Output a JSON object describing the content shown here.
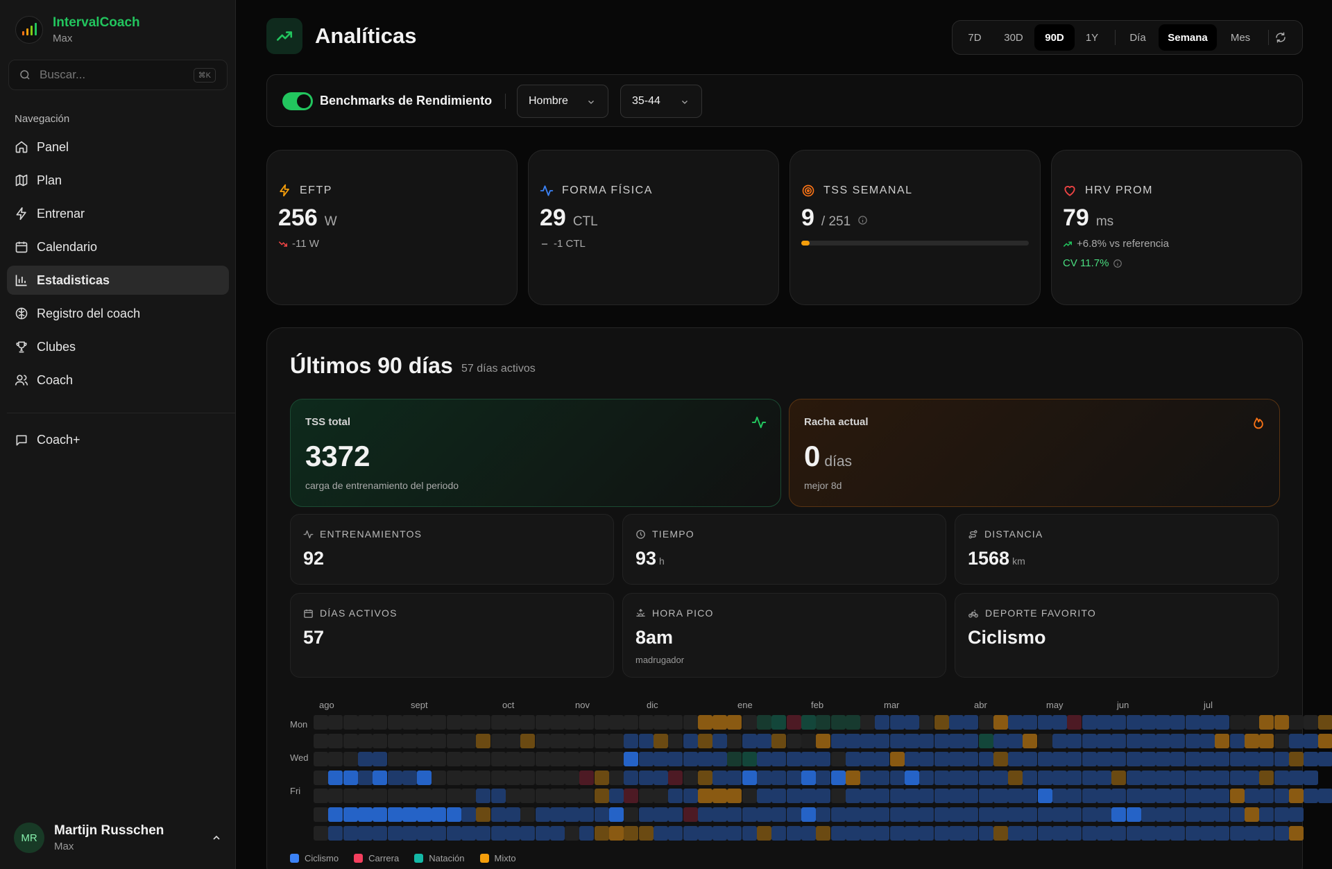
{
  "app": {
    "name": "IntervalCoach",
    "subtitle": "Max"
  },
  "search": {
    "placeholder": "Buscar...",
    "shortcut": "⌘K"
  },
  "nav": {
    "title": "Navegación",
    "items": [
      {
        "label": "Panel",
        "icon": "home-icon",
        "active": false
      },
      {
        "label": "Plan",
        "icon": "map-icon",
        "active": false
      },
      {
        "label": "Entrenar",
        "icon": "zap-icon",
        "active": false
      },
      {
        "label": "Calendario",
        "icon": "calendar-icon",
        "active": false
      },
      {
        "label": "Estadisticas",
        "icon": "bar-chart-icon",
        "active": true
      },
      {
        "label": "Registro del coach",
        "icon": "brain-icon",
        "active": false
      },
      {
        "label": "Clubes",
        "icon": "trophy-icon",
        "active": false
      },
      {
        "label": "Coach",
        "icon": "users-icon",
        "active": false
      }
    ],
    "extra": {
      "label": "Coach+",
      "icon": "message-icon"
    }
  },
  "user": {
    "initials": "MR",
    "name": "Martijn Russchen",
    "plan": "Max"
  },
  "page": {
    "title": "Analíticas",
    "icon": "trending-up-icon"
  },
  "range": {
    "periods": [
      "7D",
      "30D",
      "90D",
      "1Y"
    ],
    "active_period": "90D",
    "granularity": [
      "Día",
      "Semana",
      "Mes"
    ],
    "active_granularity": "Semana"
  },
  "benchmarks": {
    "label": "Benchmarks de Rendimiento",
    "enabled": true,
    "gender": "Hombre",
    "age": "35-44"
  },
  "kpis": {
    "eftp": {
      "label": "EFTP",
      "value": "256",
      "unit": "W",
      "delta": "-11 W",
      "icon": "zap-icon"
    },
    "fitness": {
      "label": "FORMA FÍSICA",
      "value": "29",
      "unit": "CTL",
      "delta": "-1 CTL",
      "icon": "activity-icon"
    },
    "tss": {
      "label": "TSS SEMANAL",
      "value": "9",
      "unit": "/ 251",
      "progress": 0.036,
      "icon": "target-icon"
    },
    "hrv": {
      "label": "HRV PROM",
      "value": "79",
      "unit": "ms",
      "delta": "+6.8% vs referencia",
      "cv": "CV 11.7%",
      "icon": "heart-icon"
    }
  },
  "summary": {
    "title": "Últimos 90 días",
    "subtitle": "57 días activos",
    "tss_total": {
      "label": "TSS total",
      "value": "3372",
      "sub": "carga de entrenamiento del periodo"
    },
    "streak": {
      "label": "Racha actual",
      "value": "0",
      "unit": "días",
      "sub": "mejor 8d"
    },
    "stats": [
      {
        "label": "ENTRENAMIENTOS",
        "value": "92",
        "unit": "",
        "sub": "",
        "icon": "activity-icon"
      },
      {
        "label": "TIEMPO",
        "value": "93",
        "unit": "h",
        "sub": "",
        "icon": "clock-icon"
      },
      {
        "label": "DISTANCIA",
        "value": "1568",
        "unit": "km",
        "sub": "",
        "icon": "route-icon"
      },
      {
        "label": "DÍAS ACTIVOS",
        "value": "57",
        "unit": "",
        "sub": "",
        "icon": "calendar-icon"
      },
      {
        "label": "HORA PICO",
        "value": "8am",
        "unit": "",
        "sub": "madrugador",
        "icon": "sunrise-icon"
      },
      {
        "label": "DEPORTE FAVORITO",
        "value": "Ciclismo",
        "unit": "",
        "sub": "",
        "icon": "bike-icon"
      }
    ]
  },
  "heatmap": {
    "months": [
      "ago",
      "sept",
      "oct",
      "nov",
      "dic",
      "ene",
      "feb",
      "mar",
      "abr",
      "may",
      "jun",
      "jul"
    ],
    "day_labels": [
      "Mon",
      "Wed",
      "Fri"
    ],
    "legend": [
      {
        "label": "Ciclismo",
        "color": "#3b82f6"
      },
      {
        "label": "Carrera",
        "color": "#f43f5e"
      },
      {
        "label": "Natación",
        "color": "#14b8a6"
      },
      {
        "label": "Mixto",
        "color": "#f59e0b"
      }
    ],
    "grid": [
      "..........................ooo.ntrtnnn.bbb.pbb.obbbbrbbbbbbbbbbeeooe.p",
      "...........p..p......bbp.bpb.bbp.eobbbbbbbbbbtbboebbbbbbbbbbboboo.bbo",
      "...bb................Bbbbbbbntbbbbb.bbbobbbbbbpbbbbbbbbbbbbbbbbbbbpbb",
      ".BBbBbbB..........rp.bbbr.pbbBbbbBbBobbbBbbbbbbpbbbbbbpbbbbbbbbbpbbb",
      "...........bb......pbr..bbooo.bbbbb.bbbbbbbbbbbbbBbbbbbbbbbbbbobbbobb",
      ".BBBBBBBBBbpbb.bbbbbB.bbbrbbbbbbbBbbbbbbbbbbbbbbbbbbbbBBbbbbbbbobbb",
      ".bbbbbbbbbbbbbbbb.bpoppbbbbbbbpbbbpbbbbbbbbbbbpbbbbbbbbbbbbbbbbbbbo"
    ]
  }
}
